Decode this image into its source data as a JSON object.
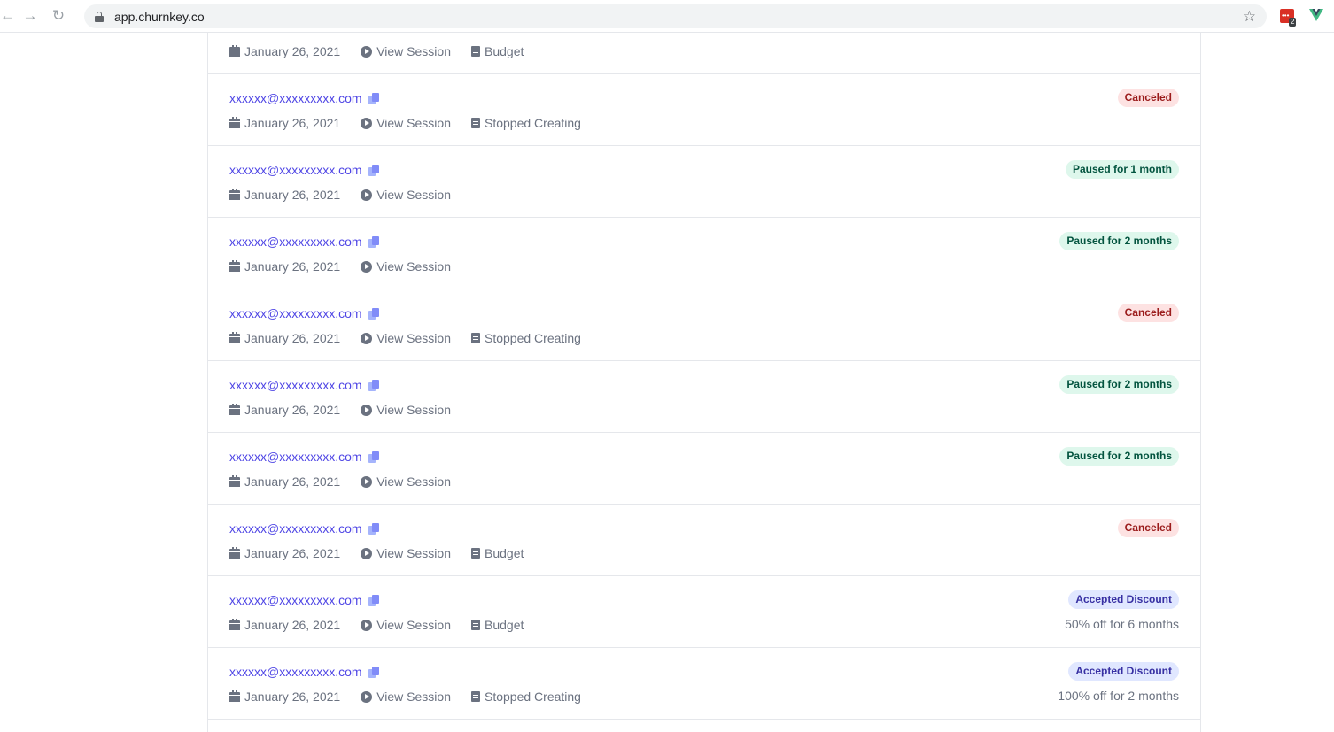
{
  "browser": {
    "url": "app.churnkey.co",
    "extension_badge_count": "2"
  },
  "rows": [
    {
      "email": "",
      "date": "January 26, 2021",
      "session_label": "View Session",
      "reason": "Budget",
      "status": "",
      "note": ""
    },
    {
      "email": "xxxxxx@xxxxxxxxx.com",
      "date": "January 26, 2021",
      "session_label": "View Session",
      "reason": "Stopped Creating",
      "status": "Canceled",
      "status_color": "red",
      "note": ""
    },
    {
      "email": "xxxxxx@xxxxxxxxx.com",
      "date": "January 26, 2021",
      "session_label": "View Session",
      "reason": "",
      "status": "Paused for 1 month",
      "status_color": "green",
      "note": ""
    },
    {
      "email": "xxxxxx@xxxxxxxxx.com",
      "date": "January 26, 2021",
      "session_label": "View Session",
      "reason": "",
      "status": "Paused for 2 months",
      "status_color": "green",
      "note": ""
    },
    {
      "email": "xxxxxx@xxxxxxxxx.com",
      "date": "January 26, 2021",
      "session_label": "View Session",
      "reason": "Stopped Creating",
      "status": "Canceled",
      "status_color": "red",
      "note": ""
    },
    {
      "email": "xxxxxx@xxxxxxxxx.com",
      "date": "January 26, 2021",
      "session_label": "View Session",
      "reason": "",
      "status": "Paused for 2 months",
      "status_color": "green",
      "note": ""
    },
    {
      "email": "xxxxxx@xxxxxxxxx.com",
      "date": "January 26, 2021",
      "session_label": "View Session",
      "reason": "",
      "status": "Paused for 2 months",
      "status_color": "green",
      "note": ""
    },
    {
      "email": "xxxxxx@xxxxxxxxx.com",
      "date": "January 26, 2021",
      "session_label": "View Session",
      "reason": "Budget",
      "status": "Canceled",
      "status_color": "red",
      "note": ""
    },
    {
      "email": "xxxxxx@xxxxxxxxx.com",
      "date": "January 26, 2021",
      "session_label": "View Session",
      "reason": "Budget",
      "status": "Accepted Discount",
      "status_color": "indigo",
      "note": "50% off for 6 months"
    },
    {
      "email": "xxxxxx@xxxxxxxxx.com",
      "date": "January 26, 2021",
      "session_label": "View Session",
      "reason": "Stopped Creating",
      "status": "Accepted Discount",
      "status_color": "indigo",
      "note": "100% off for 2 months"
    }
  ],
  "colors": {
    "link": "#4f46e5",
    "canceled_bg": "#fde2e2",
    "paused_bg": "#def7ec",
    "discount_bg": "#e0e7ff"
  }
}
